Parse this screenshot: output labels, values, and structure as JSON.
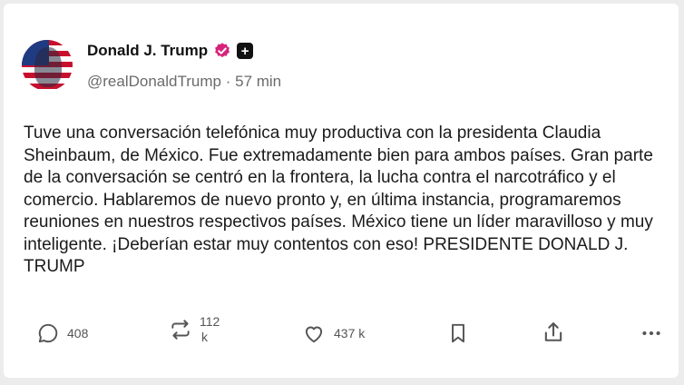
{
  "post": {
    "display_name": "Donald J. Trump",
    "handle": "@realDonaldTrump",
    "separator": "·",
    "time": "57 min",
    "body": "Tuve una conversación telefónica muy productiva con la presidenta Claudia Sheinbaum, de México. Fue extremadamente bien para ambos países. Gran parte de la conversación se centró en la frontera, la lucha contra el narcotráfico y el comercio. Hablaremos de nuevo pronto y, en última instancia, programaremos reuniones en nuestros respectivos países. México tiene un líder maravilloso y muy inteligente. ¡Deberían estar muy contentos con eso! PRESIDENTE DONALD J. TRUMP",
    "badge_plus": "+"
  },
  "actions": {
    "replies": "408",
    "retruths_line1": "112",
    "retruths_line2": "k",
    "likes": "437 k"
  },
  "icons": {
    "verified": "verified-badge-icon",
    "reply": "speech-bubble-icon",
    "retruth": "repost-arrows-icon",
    "like": "heart-icon",
    "bookmark": "bookmark-icon",
    "share": "share-upload-icon",
    "more": "more-dots-icon"
  },
  "colors": {
    "verified": "#d6247a",
    "text": "#1a1a1a",
    "muted": "#6b6b6b"
  }
}
